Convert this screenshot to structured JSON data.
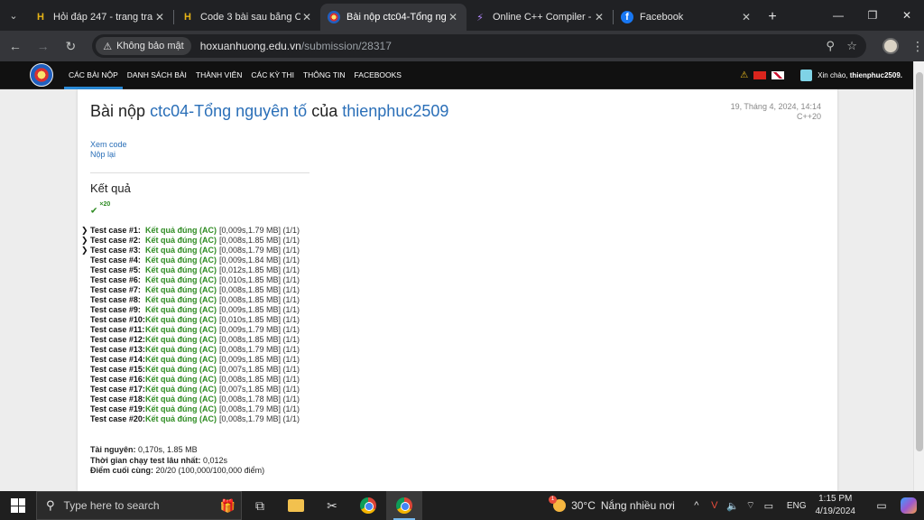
{
  "browser": {
    "tabs": [
      {
        "title": "Hỏi đáp 247 - trang tra l",
        "icon": "h-logo-icon",
        "active": false
      },
      {
        "title": "Code 3 bài sau bằng C++",
        "icon": "h-logo-icon",
        "active": false
      },
      {
        "title": "Bài nộp ctc04-Tổng nguy",
        "icon": "site-logo-icon",
        "active": true
      },
      {
        "title": "Online C++ Compiler - o",
        "icon": "compiler-icon",
        "active": false
      },
      {
        "title": "Facebook",
        "icon": "facebook-icon",
        "active": false
      }
    ],
    "security_label": "Không bảo mật",
    "url_host": "hoxuanhuong.edu.vn",
    "url_path": "/submission/28317"
  },
  "site": {
    "menu": [
      "CÁC BÀI NỘP",
      "DANH SÁCH BÀI",
      "THÀNH VIÊN",
      "CÁC KỲ THI",
      "THÔNG TIN",
      "FACEBOOKS"
    ],
    "greeting": "Xin chào,",
    "username": "thienphuc2509."
  },
  "submission": {
    "title_prefix": "Bài nộp",
    "problem": "ctc04-Tổng nguyên tố",
    "title_mid": "của",
    "user": "thienphuc2509",
    "date": "19, Tháng 4, 2024, 14:14",
    "language": "C++20",
    "view_code": "Xem code",
    "resubmit": "Nộp lại",
    "result_heading": "Kết quả",
    "ac_count": "×20"
  },
  "cases": [
    {
      "label": "Test case #1:",
      "status": "Kết quả đúng (AC)",
      "detail": "[0,009s,1.79 MB] (1/1)",
      "expandable": true
    },
    {
      "label": "Test case #2:",
      "status": "Kết quả đúng (AC)",
      "detail": "[0,008s,1.85 MB] (1/1)",
      "expandable": true
    },
    {
      "label": "Test case #3:",
      "status": "Kết quả đúng (AC)",
      "detail": "[0,008s,1.79 MB] (1/1)",
      "expandable": true
    },
    {
      "label": "Test case #4:",
      "status": "Kết quả đúng (AC)",
      "detail": "[0,009s,1.84 MB] (1/1)",
      "expandable": false
    },
    {
      "label": "Test case #5:",
      "status": "Kết quả đúng (AC)",
      "detail": "[0,012s,1.85 MB] (1/1)",
      "expandable": false
    },
    {
      "label": "Test case #6:",
      "status": "Kết quả đúng (AC)",
      "detail": "[0,010s,1.85 MB] (1/1)",
      "expandable": false
    },
    {
      "label": "Test case #7:",
      "status": "Kết quả đúng (AC)",
      "detail": "[0,008s,1.85 MB] (1/1)",
      "expandable": false
    },
    {
      "label": "Test case #8:",
      "status": "Kết quả đúng (AC)",
      "detail": "[0,008s,1.85 MB] (1/1)",
      "expandable": false
    },
    {
      "label": "Test case #9:",
      "status": "Kết quả đúng (AC)",
      "detail": "[0,009s,1.85 MB] (1/1)",
      "expandable": false
    },
    {
      "label": "Test case #10:",
      "status": "Kết quả đúng (AC)",
      "detail": "[0,010s,1.85 MB] (1/1)",
      "expandable": false
    },
    {
      "label": "Test case #11:",
      "status": "Kết quả đúng (AC)",
      "detail": "[0,009s,1.79 MB] (1/1)",
      "expandable": false
    },
    {
      "label": "Test case #12:",
      "status": "Kết quả đúng (AC)",
      "detail": "[0,008s,1.85 MB] (1/1)",
      "expandable": false
    },
    {
      "label": "Test case #13:",
      "status": "Kết quả đúng (AC)",
      "detail": "[0,008s,1.79 MB] (1/1)",
      "expandable": false
    },
    {
      "label": "Test case #14:",
      "status": "Kết quả đúng (AC)",
      "detail": "[0,009s,1.85 MB] (1/1)",
      "expandable": false
    },
    {
      "label": "Test case #15:",
      "status": "Kết quả đúng (AC)",
      "detail": "[0,007s,1.85 MB] (1/1)",
      "expandable": false
    },
    {
      "label": "Test case #16:",
      "status": "Kết quả đúng (AC)",
      "detail": "[0,008s,1.85 MB] (1/1)",
      "expandable": false
    },
    {
      "label": "Test case #17:",
      "status": "Kết quả đúng (AC)",
      "detail": "[0,007s,1.85 MB] (1/1)",
      "expandable": false
    },
    {
      "label": "Test case #18:",
      "status": "Kết quả đúng (AC)",
      "detail": "[0,008s,1.78 MB] (1/1)",
      "expandable": false
    },
    {
      "label": "Test case #19:",
      "status": "Kết quả đúng (AC)",
      "detail": "[0,008s,1.79 MB] (1/1)",
      "expandable": false
    },
    {
      "label": "Test case #20:",
      "status": "Kết quả đúng (AC)",
      "detail": "[0,008s,1.79 MB] (1/1)",
      "expandable": false
    }
  ],
  "summary": {
    "resources_label": "Tài nguyên:",
    "resources_value": "0,170s, 1.85 MB",
    "max_time_label": "Thời gian chạy test lâu nhất:",
    "max_time_value": "0,012s",
    "final_score_label": "Điểm cuối cùng:",
    "final_score_value": "20/20 (100,000/100,000 điểm)"
  },
  "taskbar": {
    "search_placeholder": "Type here to search",
    "weather_temp": "30°C",
    "weather_text": "Nắng nhiều nơi",
    "weather_badge": "1",
    "language": "ENG",
    "time": "1:15 PM",
    "date": "4/19/2024"
  },
  "colors": {
    "accent_link": "#2a6fb8",
    "ac_green": "#2e8b22",
    "nav_bg": "#111111",
    "nav_active": "#2a8bd8"
  }
}
